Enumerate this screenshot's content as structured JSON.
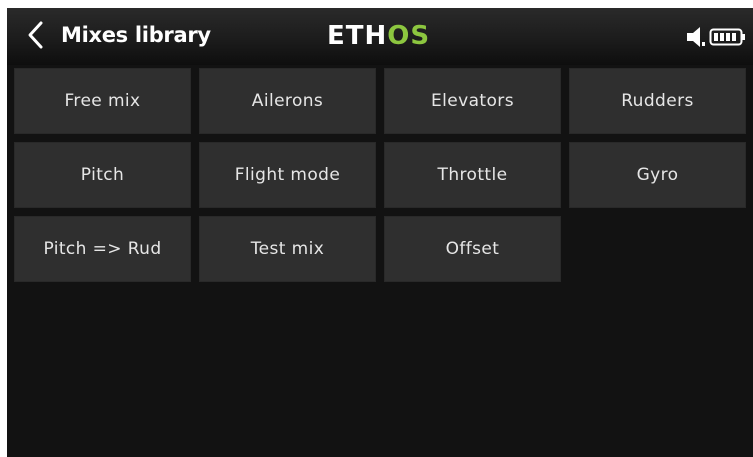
{
  "header": {
    "title": "Mixes library",
    "logo_part1": "ETH",
    "logo_part2": "OS",
    "back_icon": "chevron-left-icon",
    "speaker_icon": "speaker-icon",
    "battery_icon": "battery-icon"
  },
  "colors": {
    "background": "#121212",
    "tile": "#2f2f2f",
    "text": "#e6e6e6",
    "brand_green": "#8cc63f"
  },
  "mixes": [
    {
      "label": "Free mix"
    },
    {
      "label": "Ailerons"
    },
    {
      "label": "Elevators"
    },
    {
      "label": "Rudders"
    },
    {
      "label": "Pitch"
    },
    {
      "label": "Flight mode"
    },
    {
      "label": "Throttle"
    },
    {
      "label": "Gyro"
    },
    {
      "label": "Pitch => Rud"
    },
    {
      "label": "Test mix"
    },
    {
      "label": "Offset"
    }
  ]
}
